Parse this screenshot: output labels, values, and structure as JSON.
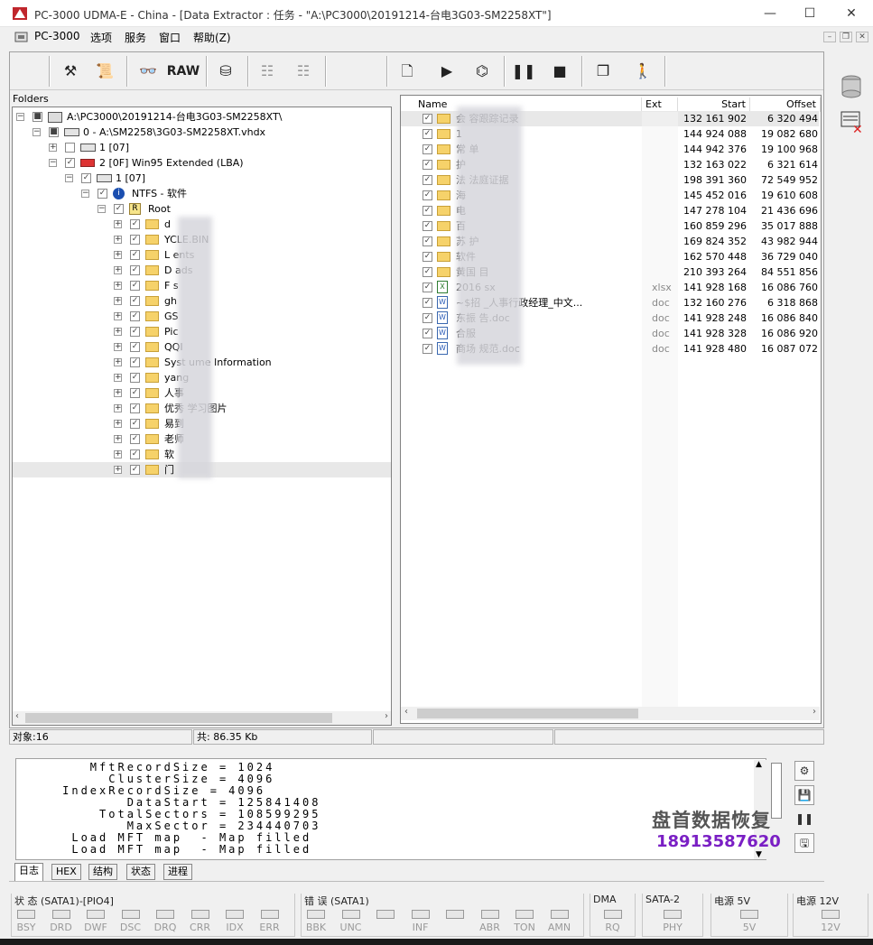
{
  "window": {
    "title": "PC-3000 UDMA-E - China - [Data Extractor : 任务 - \"A:\\PC3000\\20191214-台电3G03-SM2258XT\"]",
    "minimize": "—",
    "maximize": "☐",
    "close": "✕"
  },
  "menu": {
    "items": [
      "PC-3000",
      "选项",
      "服务",
      "窗口",
      "帮助(Z)"
    ],
    "mdi": [
      "–",
      "❐",
      "✕"
    ]
  },
  "toolbar": {
    "raw_label": "RAW"
  },
  "folders": {
    "title": "Folders",
    "tree": [
      {
        "label": "A:\\PC3000\\20191214-台电3G03-SM2258XT\\"
      },
      {
        "label": "0 - A:\\SM2258\\3G03-SM2258XT.vhdx"
      },
      {
        "label": "1 [07]"
      },
      {
        "label": "2 [0F] Win95 Extended  (LBA)"
      },
      {
        "label": "1 [07]"
      },
      {
        "label": "NTFS - 软件"
      },
      {
        "label": "Root"
      },
      {
        "label": "d"
      },
      {
        "label": "YCLE.BIN"
      },
      {
        "label": "L ents"
      },
      {
        "label": "D ads"
      },
      {
        "label": "F s"
      },
      {
        "label": "gh"
      },
      {
        "label": "GS"
      },
      {
        "label": "Pic"
      },
      {
        "label": "QQI"
      },
      {
        "label": "Syst ume Information"
      },
      {
        "label": "yang"
      },
      {
        "label": "人事"
      },
      {
        "label": "优秀 学习图片"
      },
      {
        "label": "易到"
      },
      {
        "label": "老师"
      },
      {
        "label": "软"
      },
      {
        "label": "门"
      }
    ]
  },
  "files": {
    "columns": [
      "Name",
      "Ext",
      "Start",
      "Offset"
    ],
    "rows": [
      {
        "name": "会 容跟踪记录",
        "ext": "",
        "start": "132 161 902",
        "offset": "6 320 494",
        "type": "folder"
      },
      {
        "name": "1",
        "ext": "",
        "start": "144 924 088",
        "offset": "19 082 680",
        "type": "folder"
      },
      {
        "name": "常 单",
        "ext": "",
        "start": "144 942 376",
        "offset": "19 100 968",
        "type": "folder"
      },
      {
        "name": "护",
        "ext": "",
        "start": "132 163 022",
        "offset": "6 321 614",
        "type": "folder"
      },
      {
        "name": "法 法庭证据",
        "ext": "",
        "start": "198 391 360",
        "offset": "72 549 952",
        "type": "folder"
      },
      {
        "name": "海",
        "ext": "",
        "start": "145 452 016",
        "offset": "19 610 608",
        "type": "folder"
      },
      {
        "name": "电",
        "ext": "",
        "start": "147 278 104",
        "offset": "21 436 696",
        "type": "folder"
      },
      {
        "name": "百",
        "ext": "",
        "start": "160 859 296",
        "offset": "35 017 888",
        "type": "folder"
      },
      {
        "name": "苏 护",
        "ext": "",
        "start": "169 824 352",
        "offset": "43 982 944",
        "type": "folder"
      },
      {
        "name": "软件",
        "ext": "",
        "start": "162 570 448",
        "offset": "36 729 040",
        "type": "folder"
      },
      {
        "name": "黄国 目",
        "ext": "",
        "start": "210 393 264",
        "offset": "84 551 856",
        "type": "folder"
      },
      {
        "name": "2016 sx",
        "ext": "xlsx",
        "start": "141 928 168",
        "offset": "16 086 760",
        "type": "xlsx"
      },
      {
        "name": "~$招 _人事行政经理_中文...",
        "ext": "doc",
        "start": "132 160 276",
        "offset": "6 318 868",
        "type": "doc"
      },
      {
        "name": "东振 告.doc",
        "ext": "doc",
        "start": "141 928 248",
        "offset": "16 086 840",
        "type": "doc"
      },
      {
        "name": "合服",
        "ext": "doc",
        "start": "141 928 328",
        "offset": "16 086 920",
        "type": "doc"
      },
      {
        "name": "商场 规范.doc",
        "ext": "doc",
        "start": "141 928 480",
        "offset": "16 087 072",
        "type": "doc"
      }
    ]
  },
  "status": {
    "objects": "对象:16",
    "total": "共: 86.35 Kb"
  },
  "log": {
    "lines": [
      "        MftRecordSize = 1024",
      "          ClusterSize = 4096",
      "     IndexRecordSize = 4096",
      "            DataStart = 125841408",
      "         TotalSectors = 108599295",
      "            MaxSector = 234440703",
      "      Load MFT map  - Map filled",
      "      Load MFT map  - Map filled"
    ],
    "tabs": [
      "日志",
      "HEX",
      "结构",
      "状态",
      "进程"
    ]
  },
  "indicators": {
    "status_title": "状 态 (SATA1)-[PIO4]",
    "status_leds": [
      "BSY",
      "DRD",
      "DWF",
      "DSC",
      "DRQ",
      "CRR",
      "IDX",
      "ERR"
    ],
    "error_title": "错 误 (SATA1)",
    "error_leds": [
      "BBK",
      "UNC",
      "",
      "INF",
      "",
      "ABR",
      "TON",
      "AMN"
    ],
    "dma_title": "DMA",
    "dma_leds": [
      "RQ"
    ],
    "sata_title": "SATA-2",
    "sata_leds": [
      "PHY"
    ],
    "p5_title": "电源 5V",
    "p5_leds": [
      "5V"
    ],
    "p12_title": "电源 12V",
    "p12_leds": [
      "12V"
    ]
  },
  "watermark": {
    "name": "盘首数据恢复",
    "phone": "18913587620"
  }
}
